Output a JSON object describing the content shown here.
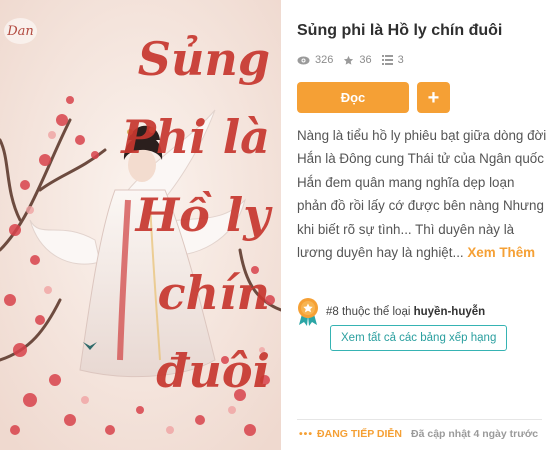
{
  "book": {
    "title": "Sủng phi là Hồ ly chín đuôi",
    "stats": {
      "views": "326",
      "rating": "36",
      "chapters": "3"
    },
    "description": "Nàng là tiểu hồ ly phiêu bạt giữa dòng đời Hắn là Đông cung Thái tử của Ngân quốc Hắn đem quân mang nghĩa dẹp loạn phản đồ rồi lấy cớ được bên nàng Nhưng khi biết rõ sự tình... Thì duyên này là lương duyên hay là nghiệt...",
    "read_more": "Xem Thêm"
  },
  "actions": {
    "read_label": "Đọc",
    "add_label": "+"
  },
  "cover": {
    "watermark": "Dan",
    "title_art": "Sủng Phi là Hồ ly chín đuôi"
  },
  "ranking": {
    "rank_prefix": "#8 thuộc thể loại",
    "genre": "huyền-huyễn",
    "view_all": "Xem tất cả các bảng xếp hạng"
  },
  "status": {
    "dots": "•••",
    "label": "ĐANG TIẾP DIỄN",
    "updated": "Đã cập nhật 4 ngày trước"
  },
  "colors": {
    "accent": "#f5a035",
    "teal": "#36b3b3",
    "title_red": "#c7372f"
  },
  "icons": {
    "views": "eye-icon",
    "rating": "star-icon",
    "chapters": "list-icon",
    "rank": "ribbon-badge-icon"
  }
}
